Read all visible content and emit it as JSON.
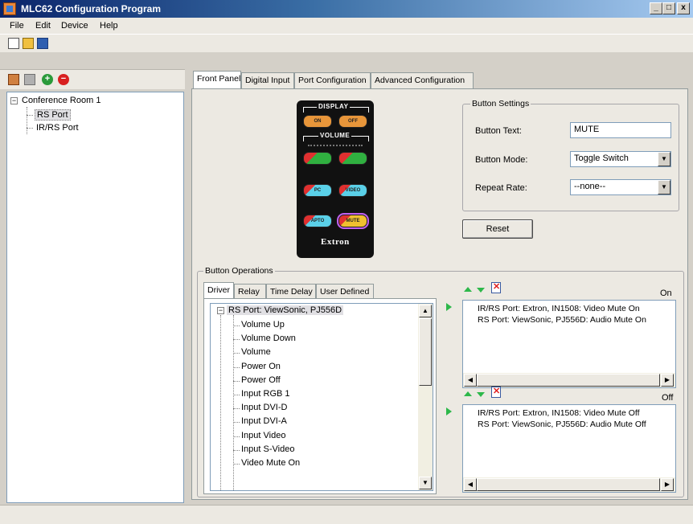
{
  "window": {
    "title": "MLC62 Configuration Program",
    "min": "_",
    "max": "□",
    "close": "x"
  },
  "menu": [
    "File",
    "Edit",
    "Device",
    "Help"
  ],
  "tree": {
    "root": "Conference Room 1",
    "items": [
      "RS Port",
      "IR/RS Port"
    ],
    "selected": "RS Port"
  },
  "tabs": [
    "Front Panel",
    "Digital Input",
    "Port Configuration",
    "Advanced Configuration"
  ],
  "device": {
    "display_label": "DISPLAY",
    "volume_label": "VOLUME",
    "brand": "Extron",
    "buttons": [
      "ON",
      "OFF",
      "",
      "",
      "PC",
      "VIDEO",
      "APTO",
      "MUTE"
    ]
  },
  "button_settings": {
    "title": "Button Settings",
    "text_label": "Button Text:",
    "text_value": "MUTE",
    "mode_label": "Button Mode:",
    "mode_value": "Toggle Switch",
    "repeat_label": "Repeat Rate:",
    "repeat_value": "--none--"
  },
  "reset_label": "Reset",
  "operations": {
    "title": "Button Operations",
    "subtabs": [
      "Driver",
      "Relay",
      "Time Delay",
      "User Defined"
    ],
    "driver_root": "RS Port: ViewSonic, PJ556D",
    "commands": [
      "Volume Up",
      "Volume Down",
      "Volume",
      "Power On",
      "Power Off",
      "Input RGB 1",
      "Input DVI-D",
      "Input DVI-A",
      "Input Video",
      "Input S-Video",
      "Video Mute On"
    ],
    "on_label": "On",
    "on_items": [
      "IR/RS Port: Extron, IN1508: Video Mute On",
      "RS Port: ViewSonic, PJ556D: Audio Mute On"
    ],
    "off_label": "Off",
    "off_items": [
      "IR/RS Port: Extron, IN1508: Video Mute Off",
      "RS Port: ViewSonic, PJ556D: Audio Mute Off"
    ]
  }
}
